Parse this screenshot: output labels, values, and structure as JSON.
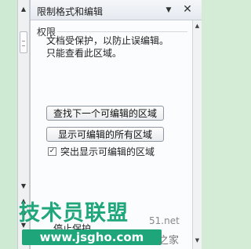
{
  "pane": {
    "title": "限制格式和编辑",
    "dropdown_icon": "▼",
    "close_icon": "✕",
    "section_label": "权限",
    "desc_line1": "文档受保护，以防止误编辑。",
    "desc_line2": "只能查看此区域。",
    "find_next_label": "查找下一个可编辑的区域",
    "show_all_label": "显示可编辑的所有区域",
    "highlight_checked": true,
    "highlight_label": "突出显示可编辑的区域",
    "partial_bottom_text": "停止保护"
  },
  "watermark": {
    "brand": "技术员联盟",
    "url": "www.jsgho.com",
    "site": "51.net",
    "home": "之家"
  },
  "colors": {
    "doc_bg": "#d4ecd6",
    "watermark_green": "#1ea57a"
  }
}
